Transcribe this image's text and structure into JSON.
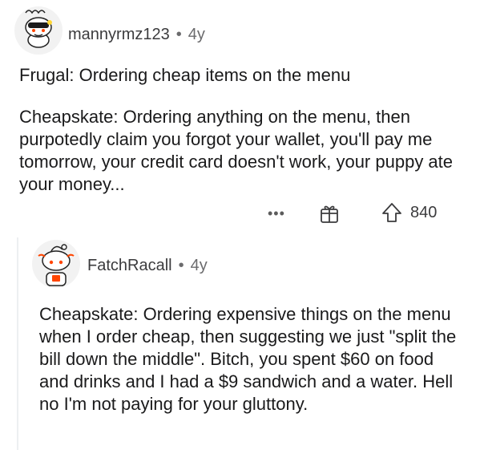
{
  "comments": [
    {
      "username": "mannyrmz123",
      "separator": "•",
      "age": "4y",
      "paragraphs": [
        "Frugal: Ordering cheap items on the menu",
        "Cheapskate: Ordering anything on the menu, then purpotedly claim you forgot your wallet, you'll pay me tomorrow, your credit card doesn't work, your puppy ate your money..."
      ],
      "actions": {
        "more_label": "•••",
        "score": "840",
        "award_icon": "gift-icon",
        "upvote_icon": "upvote-arrow-icon"
      }
    },
    {
      "username": "FatchRacall",
      "separator": "•",
      "age": "4y",
      "paragraphs": [
        "Cheapskate:  Ordering expensive things on the menu when I order cheap, then suggesting we just \"split the bill down the middle\".  Bitch, you spent $60 on food and drinks and I had a $9 sandwich and a water.  Hell no I'm not paying for your gluttony."
      ]
    }
  ],
  "colors": {
    "text": "#1a1a1b",
    "meta": "#6b6b6d",
    "avatar_accent": "#ff4500"
  }
}
